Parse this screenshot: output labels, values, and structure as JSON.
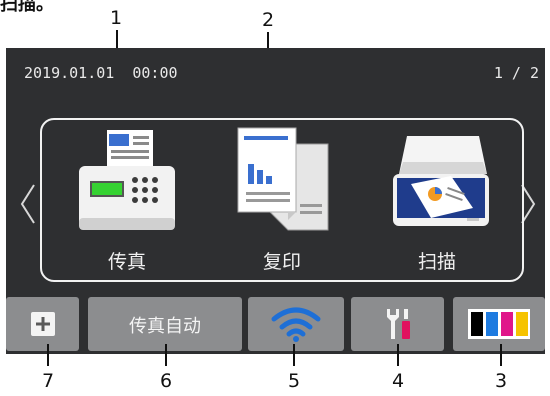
{
  "caption": "扫描。",
  "status": {
    "datetime": "2019.01.01  00:00",
    "page": "1 / 2"
  },
  "apps": [
    {
      "label": "传真",
      "icon": "fax-icon"
    },
    {
      "label": "复印",
      "icon": "copy-icon"
    },
    {
      "label": "扫描",
      "icon": "scan-icon"
    }
  ],
  "bottom_bar": {
    "plus": "plus-icon",
    "fax_mode": "传真自动",
    "wifi": "wifi-icon",
    "settings": "settings-icon",
    "ink": "ink-icon",
    "ink_colors": [
      "#000000",
      "#1e7be0",
      "#e0168a",
      "#f6c300"
    ]
  },
  "callouts": [
    "1",
    "2",
    "3",
    "4",
    "5",
    "6",
    "7"
  ]
}
